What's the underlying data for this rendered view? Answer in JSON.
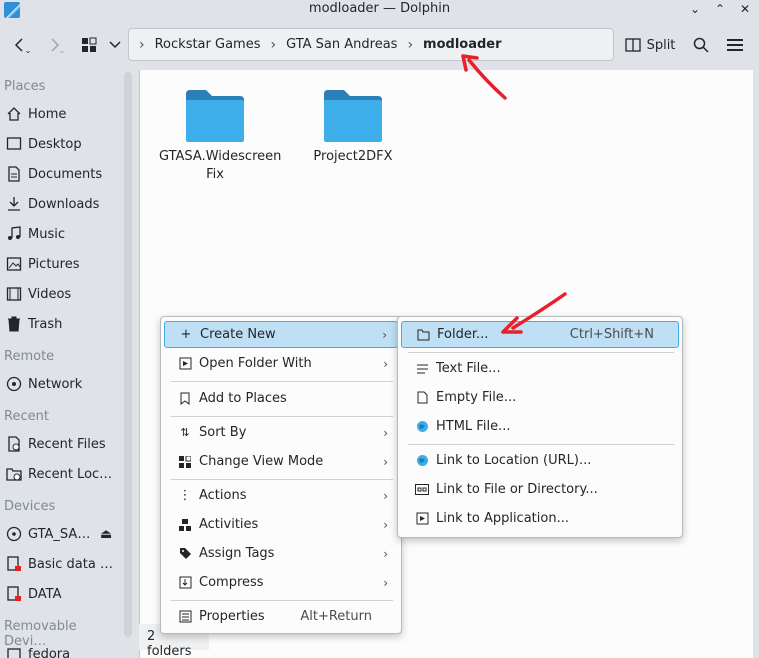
{
  "window": {
    "title": "modloader — Dolphin",
    "controls": {
      "minimize": "⌄",
      "maximize": "⌃",
      "close": "✕"
    }
  },
  "toolbar": {
    "split_label": "Split",
    "breadcrumb": [
      "Rockstar Games",
      "GTA San Andreas",
      "modloader"
    ]
  },
  "sidebar": {
    "places_header": "Places",
    "places": [
      {
        "label": "Home",
        "icon": "home-icon"
      },
      {
        "label": "Desktop",
        "icon": "desktop-icon"
      },
      {
        "label": "Documents",
        "icon": "documents-icon"
      },
      {
        "label": "Downloads",
        "icon": "downloads-icon"
      },
      {
        "label": "Music",
        "icon": "music-icon"
      },
      {
        "label": "Pictures",
        "icon": "pictures-icon"
      },
      {
        "label": "Videos",
        "icon": "videos-icon"
      },
      {
        "label": "Trash",
        "icon": "trash-icon"
      }
    ],
    "remote_header": "Remote",
    "remote": [
      {
        "label": "Network",
        "icon": "network-icon"
      }
    ],
    "recent_header": "Recent",
    "recent": [
      {
        "label": "Recent Files",
        "icon": "recent-files-icon"
      },
      {
        "label": "Recent Loc…",
        "icon": "recent-locations-icon"
      }
    ],
    "devices_header": "Devices",
    "devices": [
      {
        "label": "GTA_SA…",
        "icon": "drive-icon"
      },
      {
        "label": "Basic data …",
        "icon": "drive-icon"
      },
      {
        "label": "DATA",
        "icon": "drive-icon"
      }
    ],
    "removable_header": "Removable Devi…",
    "removable": [
      {
        "label": "fedora",
        "icon": "drive-icon"
      }
    ]
  },
  "files": [
    {
      "name": "GTASA.Widescreen\nFix",
      "line1": "GTASA.Widescreen",
      "line2": "Fix"
    },
    {
      "name": "Project2DFX",
      "line1": "Project2DFX",
      "line2": ""
    }
  ],
  "status": {
    "text": "2 folders"
  },
  "context_menu": {
    "items": [
      {
        "label": "Create New",
        "icon": "plus-icon",
        "submenu": true
      },
      {
        "label": "Open Folder With",
        "icon": "open-with-icon",
        "submenu": true
      },
      {
        "label": "Add to Places",
        "icon": "bookmark-icon",
        "submenu": false
      },
      {
        "label": "Sort By",
        "icon": "sort-icon",
        "submenu": true
      },
      {
        "label": "Change View Mode",
        "icon": "view-mode-icon",
        "submenu": true
      },
      {
        "label": "Actions",
        "icon": "actions-icon",
        "submenu": true
      },
      {
        "label": "Activities",
        "icon": "activities-icon",
        "submenu": true
      },
      {
        "label": "Assign Tags",
        "icon": "tag-icon",
        "submenu": true
      },
      {
        "label": "Compress",
        "icon": "compress-icon",
        "submenu": true
      },
      {
        "label": "Properties",
        "icon": "properties-icon",
        "shortcut": "Alt+Return"
      }
    ]
  },
  "create_new_menu": {
    "items": [
      {
        "label": "Folder...",
        "icon": "folder-icon",
        "shortcut": "Ctrl+Shift+N"
      },
      {
        "label": "Text File...",
        "icon": "text-file-icon"
      },
      {
        "label": "Empty File...",
        "icon": "empty-file-icon"
      },
      {
        "label": "HTML File...",
        "icon": "html-file-icon"
      },
      {
        "label": "Link to Location (URL)...",
        "icon": "link-url-icon"
      },
      {
        "label": "Link to File or Directory...",
        "icon": "link-file-icon"
      },
      {
        "label": "Link to Application...",
        "icon": "link-app-icon"
      }
    ]
  },
  "colors": {
    "accent": "#3daee9",
    "highlight": "#bfdff4",
    "folder": "#3daee9",
    "annotation_arrow": "#e8202a"
  }
}
